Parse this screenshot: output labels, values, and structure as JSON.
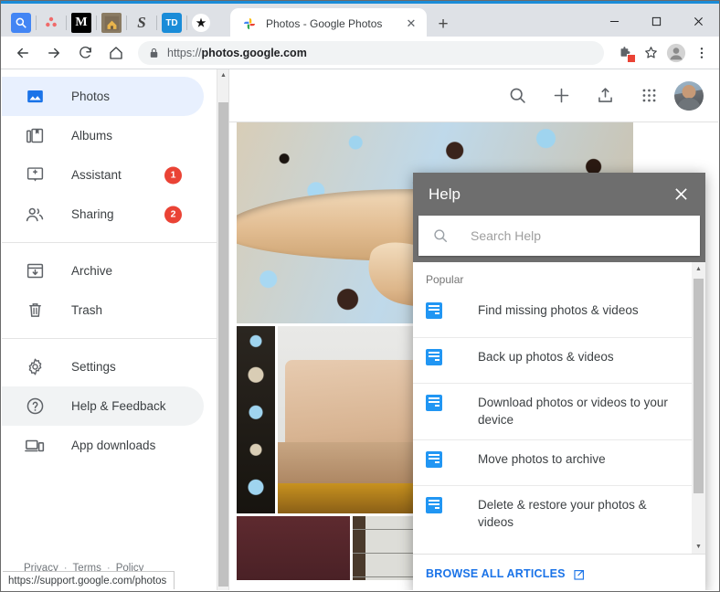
{
  "browser": {
    "extensions": [
      {
        "name": "google-search-extension-icon",
        "glyph": "G"
      },
      {
        "name": "asana-extension-icon",
        "glyph": "∴"
      },
      {
        "name": "medium-extension-icon",
        "glyph": "M"
      },
      {
        "name": "house-extension-icon",
        "glyph": "⌂"
      },
      {
        "name": "s-extension-icon",
        "glyph": "S"
      },
      {
        "name": "todoist-extension-icon",
        "glyph": "TD"
      },
      {
        "name": "bookmark-star-extension-icon",
        "glyph": "★"
      }
    ],
    "tab": {
      "title": "Photos - Google Photos",
      "close_label": "✕"
    },
    "new_tab_label": "+",
    "window_controls": {
      "minimize": "–",
      "maximize": "□",
      "close": "✕"
    },
    "nav": {
      "back": "←",
      "forward": "→",
      "reload": "↻",
      "home": "⌂"
    },
    "omnibox": {
      "lock": "🔒",
      "scheme": "https://",
      "host": "photos.google.com",
      "full_url": "https://photos.google.com"
    },
    "omnibox_right": {
      "extension_badge": "extension-puzzle-icon",
      "bookmark": "☆",
      "profile": "profile-avatar-icon",
      "menu": "⋮"
    },
    "status_url": "https://support.google.com/photos"
  },
  "sidebar": {
    "items": [
      {
        "label": "Photos",
        "icon": "photo-icon",
        "state": "active",
        "badge": null
      },
      {
        "label": "Albums",
        "icon": "albums-icon",
        "state": "",
        "badge": null
      },
      {
        "label": "Assistant",
        "icon": "assistant-icon",
        "state": "",
        "badge": "1"
      },
      {
        "label": "Sharing",
        "icon": "sharing-icon",
        "state": "",
        "badge": "2"
      },
      {
        "label": "Archive",
        "icon": "archive-icon",
        "state": "",
        "badge": null
      },
      {
        "label": "Trash",
        "icon": "trash-icon",
        "state": "",
        "badge": null
      },
      {
        "label": "Settings",
        "icon": "settings-gear-icon",
        "state": "",
        "badge": null
      },
      {
        "label": "Help & Feedback",
        "icon": "help-circle-icon",
        "state": "hover",
        "badge": null
      },
      {
        "label": "App downloads",
        "icon": "devices-icon",
        "state": "",
        "badge": null
      }
    ],
    "footer": {
      "privacy": "Privacy",
      "terms": "Terms",
      "policy": "Policy",
      "separator": "·"
    }
  },
  "app_header": {
    "actions": [
      {
        "name": "search-icon",
        "glyph": "🔍"
      },
      {
        "name": "add-icon",
        "glyph": "+"
      },
      {
        "name": "upload-icon",
        "glyph": "↑"
      },
      {
        "name": "apps-grid-icon",
        "glyph": "⋮⋮⋮"
      }
    ],
    "avatar": "account-avatar"
  },
  "help_panel": {
    "title": "Help",
    "close_label": "✕",
    "search": {
      "placeholder": "Search Help",
      "value": "",
      "icon": "search-icon"
    },
    "section_label": "Popular",
    "articles": [
      {
        "title": "Find missing photos & videos",
        "icon": "article-icon"
      },
      {
        "title": "Back up photos & videos",
        "icon": "article-icon"
      },
      {
        "title": "Download photos or videos to your device",
        "icon": "article-icon"
      },
      {
        "title": "Move photos to archive",
        "icon": "article-icon"
      },
      {
        "title": "Delete & restore your photos & videos",
        "icon": "article-icon"
      }
    ],
    "browse_all": {
      "label": "BROWSE ALL ARTICLES",
      "icon": "external-link-icon"
    },
    "scroll": {
      "up": "▲",
      "down": "▼"
    }
  },
  "page_scroll": {
    "up": "▲",
    "down": "▼"
  },
  "colors": {
    "accent_blue": "#1a73e8",
    "badge_red": "#ea4335",
    "active_nav_bg": "#e8f0fe",
    "help_header_gray": "#6e6e6e",
    "article_icon_blue": "#2196f3",
    "chrome_titlebar": "#dee1e6",
    "window_top_border": "#1a8cd8"
  }
}
